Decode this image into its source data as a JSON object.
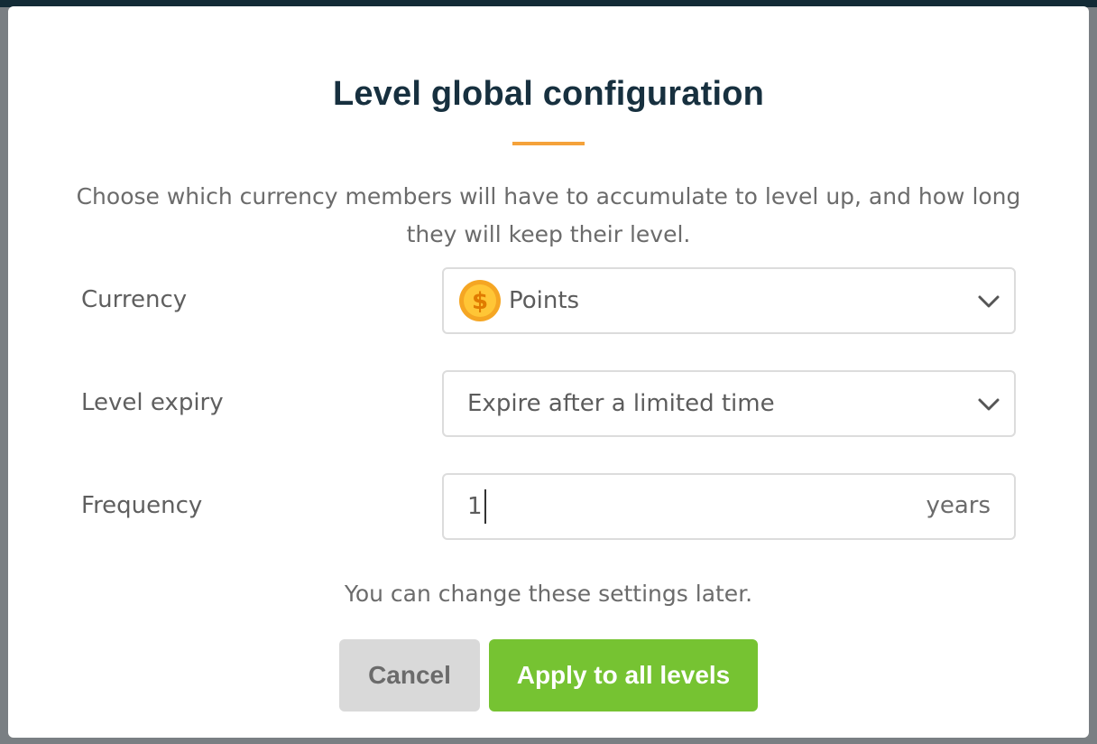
{
  "modal": {
    "title": "Level global configuration",
    "description": "Choose which currency members will have to accumulate to level up, and how long they will keep their level.",
    "note": "You can change these settings later."
  },
  "fields": {
    "currency": {
      "label": "Currency",
      "value": "Points",
      "icon": "coin-icon"
    },
    "level_expiry": {
      "label": "Level expiry",
      "value": "Expire after a limited time"
    },
    "frequency": {
      "label": "Frequency",
      "value": "1",
      "suffix": "years"
    }
  },
  "buttons": {
    "cancel": "Cancel",
    "apply": "Apply to all levels"
  },
  "colors": {
    "accent": "#f5a23a",
    "primary": "#76c332",
    "title": "#17303f"
  }
}
